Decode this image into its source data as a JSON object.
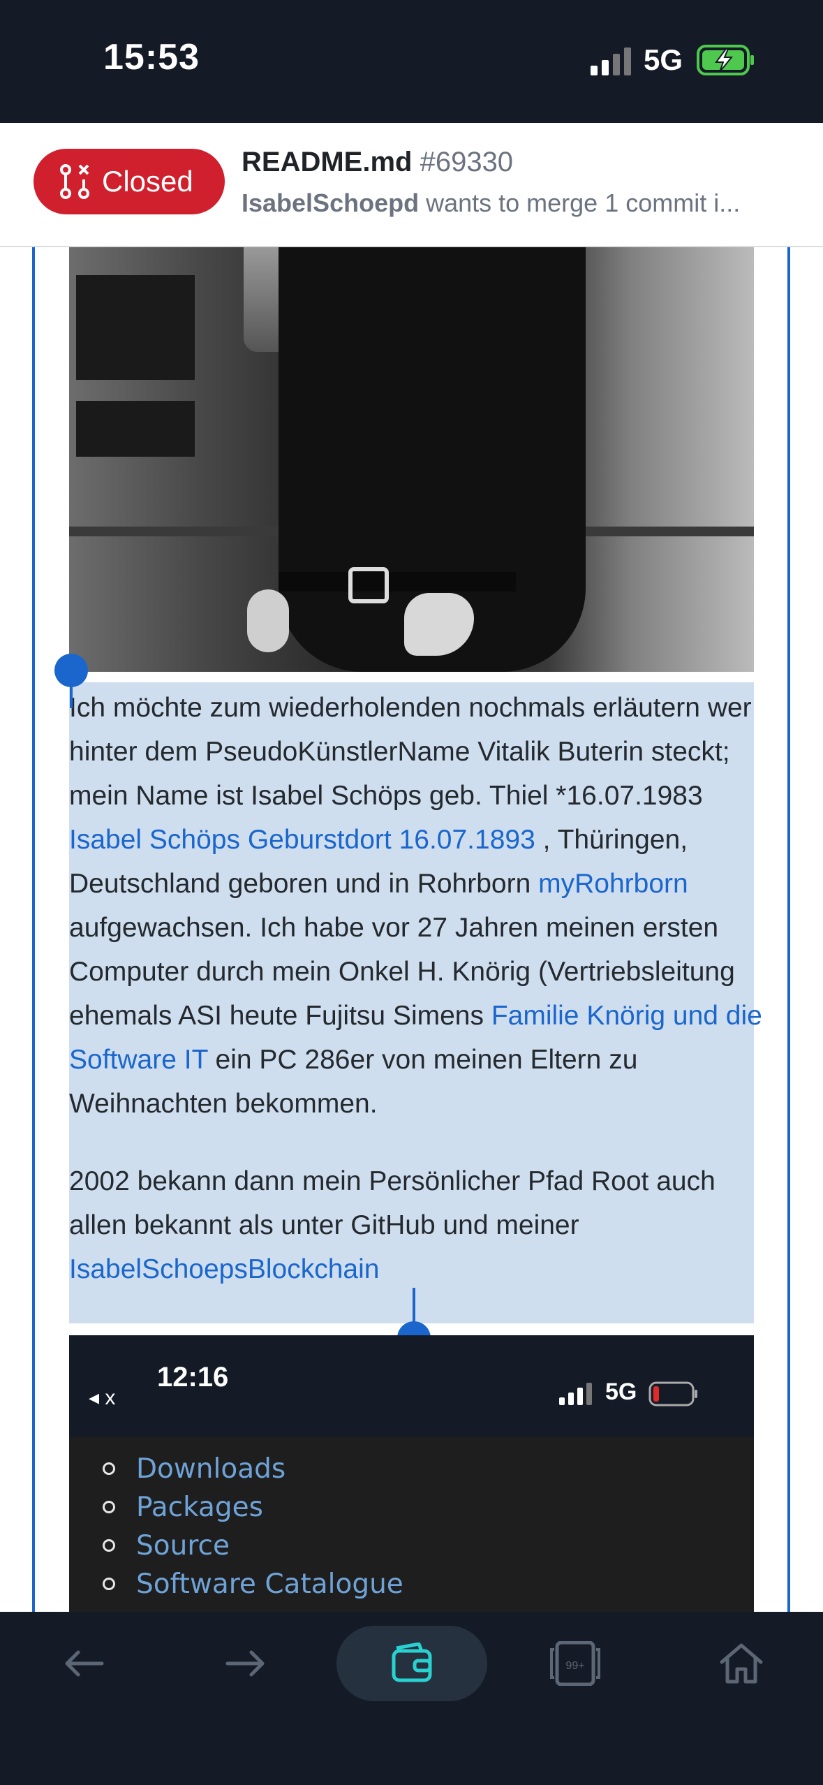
{
  "status_bar": {
    "time": "15:53",
    "network": "5G",
    "battery": "charging"
  },
  "pr_header": {
    "status_label": "Closed",
    "title": "README.md",
    "number": "#69330",
    "author": "IsabelSchoepd",
    "subtitle": "wants to merge 1 commit i..."
  },
  "content": {
    "paragraph1": {
      "text_a": "Ich möchte zum wiederholenden nochmals erläutern wer hinter dem PseudoKünstlerName Vitalik Buterin steckt; mein Name ist Isabel Schöps geb. Thiel *16.07.1983 ",
      "link_a": "Isabel Schöps Geburstdort 16.07.1893",
      "text_b": " , Thüringen, Deutschland geboren und in Rohrborn ",
      "link_b": "myRohrborn",
      "text_c": " aufgewachsen. Ich habe vor 27 Jahren meinen ersten Computer durch mein Onkel H. Knörig (Vertriebsleitung ehemals ASI heute Fujitsu Simens ",
      "link_c": "Familie Knörig und die Software IT",
      "text_d": " ein PC 286er von meinen Eltern zu Weihnachten bekommen."
    },
    "paragraph2": {
      "text_a": "2002 bekann dann mein Persönlicher Pfad Root auch allen bekannt als unter GitHub und meiner ",
      "link_a": "IsabelSchoepsBlockchain"
    },
    "embedded_screenshot": {
      "back_label": "◂ x",
      "time": "12:16",
      "network": "5G",
      "links": [
        "Downloads",
        "Packages",
        "Source",
        "Software Catalogue"
      ]
    }
  },
  "toolbar": {
    "items": [
      "back-arrow-icon",
      "forward-arrow-icon",
      "wallet-icon",
      "tabs-icon",
      "home-icon"
    ],
    "tabs_count": "99+"
  },
  "colors": {
    "accent": "#1a66cc",
    "closed": "#d0202e",
    "bar": "#151b26",
    "toolbar_accent": "#2ad1d1"
  }
}
